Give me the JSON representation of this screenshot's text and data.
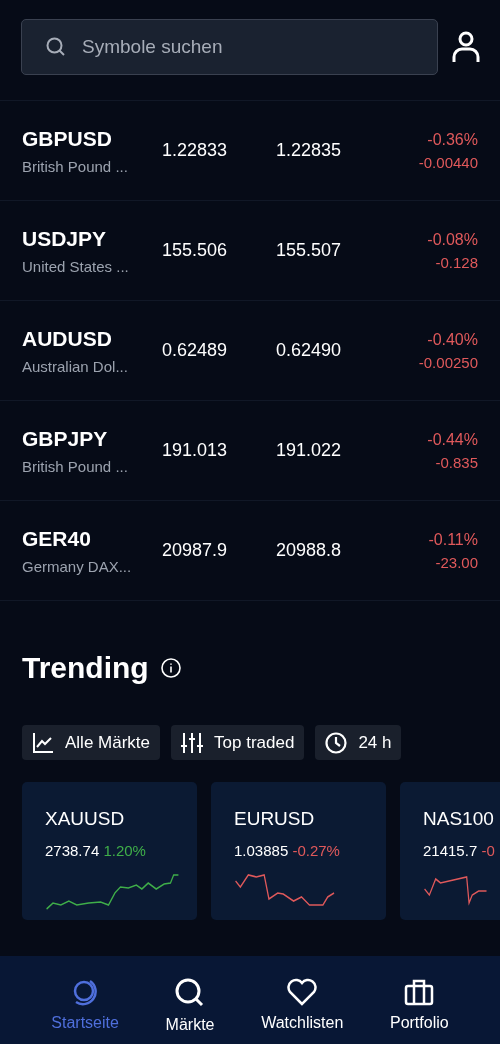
{
  "search": {
    "placeholder": "Symbole suchen"
  },
  "rows": [
    {
      "symbol": "GBPUSD",
      "name": "British Pound ...",
      "bid": "1.22833",
      "ask": "1.22835",
      "change_pct": "-0.36%",
      "change": "-0.00440",
      "color": "#e0595b"
    },
    {
      "symbol": "USDJPY",
      "name": "United States ...",
      "bid": "155.506",
      "ask": "155.507",
      "change_pct": "-0.08%",
      "change": "-0.128",
      "color": "#e0595b"
    },
    {
      "symbol": "AUDUSD",
      "name": "Australian Dol...",
      "bid": "0.62489",
      "ask": "0.62490",
      "change_pct": "-0.40%",
      "change": "-0.00250",
      "color": "#e0595b"
    },
    {
      "symbol": "GBPJPY",
      "name": "British Pound ...",
      "bid": "191.013",
      "ask": "191.022",
      "change_pct": "-0.44%",
      "change": "-0.835",
      "color": "#e0595b"
    },
    {
      "symbol": "GER40",
      "name": "Germany DAX...",
      "bid": "20987.9",
      "ask": "20988.8",
      "change_pct": "-0.11%",
      "change": "-23.00",
      "color": "#e0595b"
    }
  ],
  "trending": {
    "title": "Trending",
    "filters": [
      {
        "kind": "chart",
        "label": "Alle Märkte"
      },
      {
        "kind": "sliders",
        "label": "Top traded"
      },
      {
        "kind": "clock",
        "label": "24 h"
      }
    ],
    "cards": [
      {
        "symbol": "XAUUSD",
        "price": "2738.74",
        "change": "1.20%",
        "color": "#3fae49"
      },
      {
        "symbol": "EURUSD",
        "price": "1.03885",
        "change": "-0.27%",
        "color": "#e0595b"
      },
      {
        "symbol": "NAS100",
        "price": "21415.7",
        "change": "-0",
        "color": "#e0595b"
      }
    ]
  },
  "nav": [
    {
      "kind": "home",
      "label": "Startseite",
      "selected": true
    },
    {
      "kind": "search",
      "label": "Märkte",
      "selected": false
    },
    {
      "kind": "heart",
      "label": "Watchlisten",
      "selected": false
    },
    {
      "kind": "briefcase",
      "label": "Portfolio",
      "selected": false
    }
  ]
}
